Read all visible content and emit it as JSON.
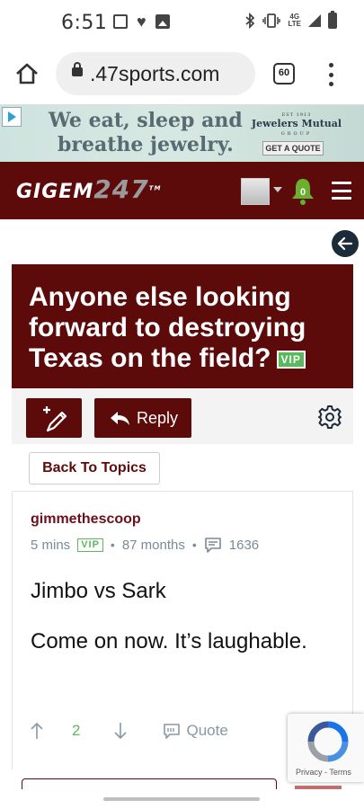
{
  "status_bar": {
    "time": "6:51",
    "network": "4G",
    "network_sub": "LTE",
    "icons": [
      "screen-record-icon",
      "heart-icon",
      "image-icon",
      "bluetooth-icon",
      "vibrate-icon",
      "signal-icon",
      "battery-icon"
    ]
  },
  "browser": {
    "url": ".47sports.com",
    "tab_count": "60"
  },
  "ad": {
    "line1": "We eat, sleep and",
    "line2": "breathe jewelry.",
    "brand_est": "EST 1913",
    "brand_name": "Jewelers Mutual",
    "brand_group": "GROUP",
    "cta": "GET A QUOTE"
  },
  "site": {
    "logo_text": "GIGEM",
    "logo_num": "247",
    "logo_tm": "TM",
    "notification_count": "0",
    "colors": {
      "maroon": "#5c0a0a",
      "vip_green": "#5cb85c",
      "notif_green": "#6aaf2e"
    }
  },
  "topic": {
    "title": "Anyone else looking forward to destroying Texas on the field?",
    "vip_badge": "VIP",
    "reply_label": "Reply",
    "back_label": "Back To Topics"
  },
  "post": {
    "author": "gimmethescoop",
    "time_ago": "5 mins",
    "vip_badge": "VIP",
    "member_age": "87 months",
    "post_count": "1636",
    "body": [
      "Jimbo vs Sark",
      "Come on now. It’s laughable."
    ],
    "vote_count": "2",
    "quote_label": "Quote"
  },
  "recaptcha": {
    "privacy": "Privacy",
    "separator": " - ",
    "terms": "Terms"
  }
}
